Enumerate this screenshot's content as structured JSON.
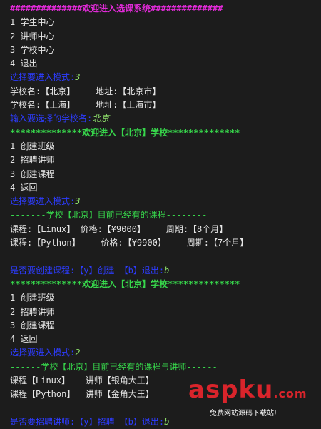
{
  "colors": {
    "background": "#1c1c1c",
    "default_text": "#e6e6e6",
    "title_magenta": "#e22ad8",
    "header_green": "#37d64b",
    "prompt_blue": "#2d3cff",
    "input_green": "#8fe06b"
  },
  "lines": [
    {
      "text": "##############欢迎进入选课系统##############",
      "style": "magenta"
    },
    {
      "text": "1 学生中心",
      "style": "default"
    },
    {
      "text": "2 讲师中心",
      "style": "default"
    },
    {
      "text": "3 学校中心",
      "style": "default"
    },
    {
      "text": "4 退出",
      "style": "default"
    },
    {
      "text": "选择要进入模式:",
      "value": "3",
      "style": "prompt"
    },
    {
      "text": "学校名:【北京】    地址:【北京市】",
      "style": "default"
    },
    {
      "text": "学校名:【上海】    地址:【上海市】",
      "style": "default"
    },
    {
      "text": "输入要选择的学校名:",
      "value": "北京",
      "style": "prompt-green"
    },
    {
      "text": "**************欢迎进入【北京】学校**************",
      "style": "green"
    },
    {
      "text": "1 创建班级",
      "style": "default"
    },
    {
      "text": "2 招聘讲师",
      "style": "default"
    },
    {
      "text": "3 创建课程",
      "style": "default"
    },
    {
      "text": "4 返回",
      "style": "default"
    },
    {
      "text": "选择要进入模式:",
      "value": "3",
      "style": "prompt"
    },
    {
      "text": "-------学校【北京】目前已经有的课程--------",
      "style": "green-plain"
    },
    {
      "text": "课程:【Linux】 价格:【¥9000】    周期:【8个月】",
      "style": "default"
    },
    {
      "text": "课程:【Python】    价格:【¥9900】    周期:【7个月】",
      "style": "default"
    },
    {
      "text": "",
      "style": "blank"
    },
    {
      "text": "是否要创建课程:【y】创建 【b】退出:",
      "value": "b",
      "style": "prompt"
    },
    {
      "text": "**************欢迎进入【北京】学校**************",
      "style": "green"
    },
    {
      "text": "1 创建班级",
      "style": "default"
    },
    {
      "text": "2 招聘讲师",
      "style": "default"
    },
    {
      "text": "3 创建课程",
      "style": "default"
    },
    {
      "text": "4 返回",
      "style": "default"
    },
    {
      "text": "选择要进入模式:",
      "value": "2",
      "style": "prompt"
    },
    {
      "text": "------学校【北京】目前已经有的课程与讲师------",
      "style": "green-plain"
    },
    {
      "text": "课程【Linux】   讲师【银角大王】",
      "style": "default"
    },
    {
      "text": "课程【Python】  讲师【金角大王】",
      "style": "default"
    },
    {
      "text": "",
      "style": "blank"
    },
    {
      "text": "是否要招聘讲师:【y】招聘 【b】退出:",
      "value": "b",
      "style": "prompt"
    }
  ],
  "watermark": {
    "logo_part1": "asp",
    "logo_part2": "ku",
    "logo_part3": ".com",
    "subtitle": "免费网站源码下载站!"
  }
}
